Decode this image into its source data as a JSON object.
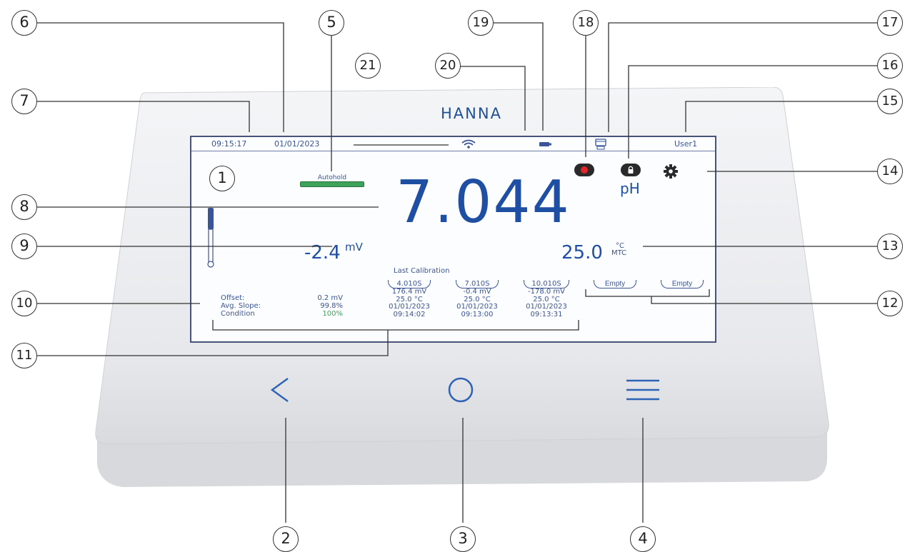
{
  "brand": "HANNA",
  "status_bar": {
    "time": "09:15:17",
    "date": "01/01/2023",
    "user": "User1"
  },
  "autohold_label": "Autohold",
  "reading": {
    "value": "7.044",
    "unit": "pH"
  },
  "mv": {
    "value": "-2.4",
    "unit": "mV"
  },
  "temperature": {
    "value": "25.0",
    "unit": "°C",
    "mode": "MTC"
  },
  "probe": {
    "labels": [
      "Offset:",
      "Avg. Slope:",
      "Condition"
    ],
    "values": [
      "0.2 mV",
      "99.8%",
      "100%"
    ]
  },
  "calibration": {
    "title": "Last Calibration",
    "buffers": [
      {
        "name": "4.010S",
        "mv": "176.4 mV",
        "temp": "25.0 °C",
        "date": "01/01/2023",
        "time": "09:14:02"
      },
      {
        "name": "7.010S",
        "mv": "-0.4 mV",
        "temp": "25.0 °C",
        "date": "01/01/2023",
        "time": "09:13:00"
      },
      {
        "name": "10.010S",
        "mv": "-178.0 mV",
        "temp": "25.0 °C",
        "date": "01/01/2023",
        "time": "09:13:31"
      }
    ],
    "empty_slots": [
      "Empty",
      "Empty"
    ]
  },
  "colors": {
    "screen_text": "#3a5496",
    "reading": "#1f4fa3",
    "autohold": "#3ea35a",
    "record": "#e0262c"
  },
  "callouts": [
    "1",
    "2",
    "3",
    "4",
    "5",
    "6",
    "7",
    "8",
    "9",
    "10",
    "11",
    "12",
    "13",
    "14",
    "15",
    "16",
    "17",
    "18",
    "19",
    "20",
    "21"
  ]
}
